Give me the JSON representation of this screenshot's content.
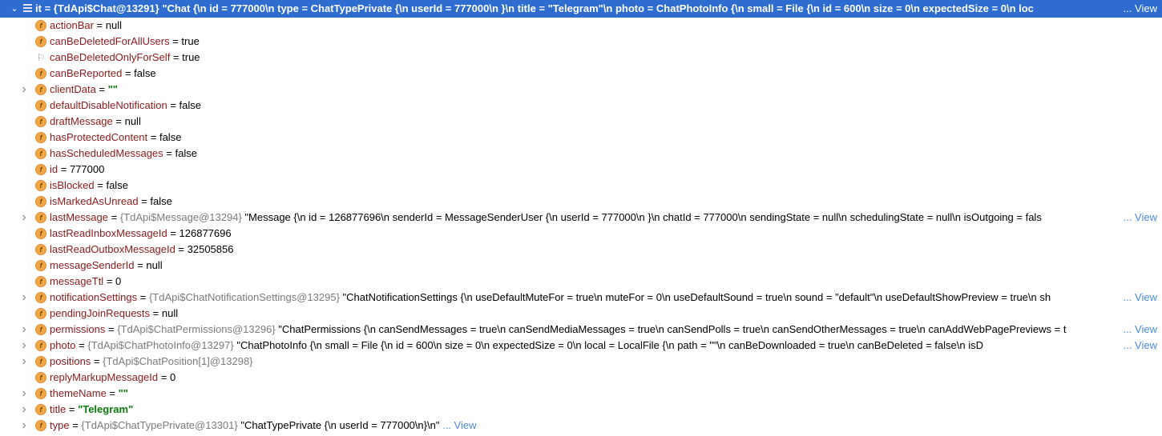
{
  "header": {
    "name": "it",
    "ref": "{TdApi$Chat@13291}",
    "value": "\"Chat {\\n  id = 777000\\n  type = ChatTypePrivate {\\n    userId = 777000\\n  }\\n  title = \"Telegram\"\\n  photo = ChatPhotoInfo {\\n    small = File {\\n      id = 600\\n      size = 0\\n      expectedSize = 0\\n      loc",
    "view_label": "... View"
  },
  "rows": [
    {
      "name": "actionBar",
      "op": " = ",
      "value": "null",
      "expandable": false,
      "icon": "field-icon"
    },
    {
      "name": "canBeDeletedForAllUsers",
      "op": " = ",
      "value": "true",
      "expandable": false,
      "icon": "field-icon"
    },
    {
      "name": "canBeDeletedOnlyForSelf",
      "op": " = ",
      "value": "true",
      "expandable": false,
      "icon": "flag-icon"
    },
    {
      "name": "canBeReported",
      "op": " = ",
      "value": "false",
      "expandable": false,
      "icon": "field-icon"
    },
    {
      "name": "clientData",
      "op": " = ",
      "value": "\"\"",
      "string": true,
      "expandable": true,
      "icon": "field-icon"
    },
    {
      "name": "defaultDisableNotification",
      "op": " = ",
      "value": "false",
      "expandable": false,
      "icon": "field-icon"
    },
    {
      "name": "draftMessage",
      "op": " = ",
      "value": "null",
      "expandable": false,
      "icon": "field-icon"
    },
    {
      "name": "hasProtectedContent",
      "op": " = ",
      "value": "false",
      "expandable": false,
      "icon": "field-icon"
    },
    {
      "name": "hasScheduledMessages",
      "op": " = ",
      "value": "false",
      "expandable": false,
      "icon": "field-icon"
    },
    {
      "name": "id",
      "op": " = ",
      "value": "777000",
      "expandable": false,
      "icon": "field-icon"
    },
    {
      "name": "isBlocked",
      "op": " = ",
      "value": "false",
      "expandable": false,
      "icon": "field-icon"
    },
    {
      "name": "isMarkedAsUnread",
      "op": " = ",
      "value": "false",
      "expandable": false,
      "icon": "field-icon"
    },
    {
      "name": "lastMessage",
      "op": " = ",
      "ref": "{TdApi$Message@13294}",
      "value": " \"Message {\\n  id = 126877696\\n  senderId = MessageSenderUser {\\n    userId = 777000\\n  }\\n  chatId = 777000\\n  sendingState = null\\n  schedulingState = null\\n  isOutgoing = fals",
      "expandable": true,
      "icon": "field-icon",
      "view": "... View"
    },
    {
      "name": "lastReadInboxMessageId",
      "op": " = ",
      "value": "126877696",
      "expandable": false,
      "icon": "field-icon"
    },
    {
      "name": "lastReadOutboxMessageId",
      "op": " = ",
      "value": "32505856",
      "expandable": false,
      "icon": "field-icon"
    },
    {
      "name": "messageSenderId",
      "op": " = ",
      "value": "null",
      "expandable": false,
      "icon": "field-icon"
    },
    {
      "name": "messageTtl",
      "op": " = ",
      "value": "0",
      "expandable": false,
      "icon": "field-icon"
    },
    {
      "name": "notificationSettings",
      "op": " = ",
      "ref": "{TdApi$ChatNotificationSettings@13295}",
      "value": " \"ChatNotificationSettings {\\n  useDefaultMuteFor = true\\n  muteFor = 0\\n  useDefaultSound = true\\n  sound = \"default\"\\n  useDefaultShowPreview = true\\n  sh",
      "expandable": true,
      "icon": "field-icon",
      "view": "... View"
    },
    {
      "name": "pendingJoinRequests",
      "op": " = ",
      "value": "null",
      "expandable": false,
      "icon": "field-icon"
    },
    {
      "name": "permissions",
      "op": " = ",
      "ref": "{TdApi$ChatPermissions@13296}",
      "value": " \"ChatPermissions {\\n  canSendMessages = true\\n  canSendMediaMessages = true\\n  canSendPolls = true\\n  canSendOtherMessages = true\\n  canAddWebPagePreviews = t",
      "expandable": true,
      "icon": "field-icon",
      "view": "... View"
    },
    {
      "name": "photo",
      "op": " = ",
      "ref": "{TdApi$ChatPhotoInfo@13297}",
      "value": " \"ChatPhotoInfo {\\n  small = File {\\n    id = 600\\n    size = 0\\n    expectedSize = 0\\n    local = LocalFile {\\n      path = \"\"\\n      canBeDownloaded = true\\n      canBeDeleted = false\\n      isD",
      "expandable": true,
      "icon": "field-icon",
      "view": "... View"
    },
    {
      "name": "positions",
      "op": " = ",
      "ref": "{TdApi$ChatPosition[1]@13298}",
      "value": "",
      "expandable": true,
      "icon": "field-icon"
    },
    {
      "name": "replyMarkupMessageId",
      "op": " = ",
      "value": "0",
      "expandable": false,
      "icon": "field-icon"
    },
    {
      "name": "themeName",
      "op": " = ",
      "value": "\"\"",
      "string": true,
      "expandable": true,
      "icon": "field-icon"
    },
    {
      "name": "title",
      "op": " = ",
      "value": "\"Telegram\"",
      "string": true,
      "expandable": true,
      "icon": "field-icon"
    },
    {
      "name": "type",
      "op": " = ",
      "ref": "{TdApi$ChatTypePrivate@13301}",
      "value": " \"ChatTypePrivate {\\n  userId = 777000\\n}\\n\"",
      "expandable": true,
      "icon": "field-icon",
      "view": "... View",
      "inline_view": true
    }
  ],
  "icons": {
    "expand": "chevron-right-icon",
    "collapse": "chevron-down-icon",
    "field": "field-icon",
    "flag": "flag-icon",
    "list": "list-icon"
  },
  "colors": {
    "selection": "#2e6ccf",
    "field_name": "#8b1a1a",
    "string_value": "#0a7a0a",
    "reference": "#7b7b7b",
    "view_link": "#4a8ad8",
    "field_icon": "#f2a84a"
  }
}
